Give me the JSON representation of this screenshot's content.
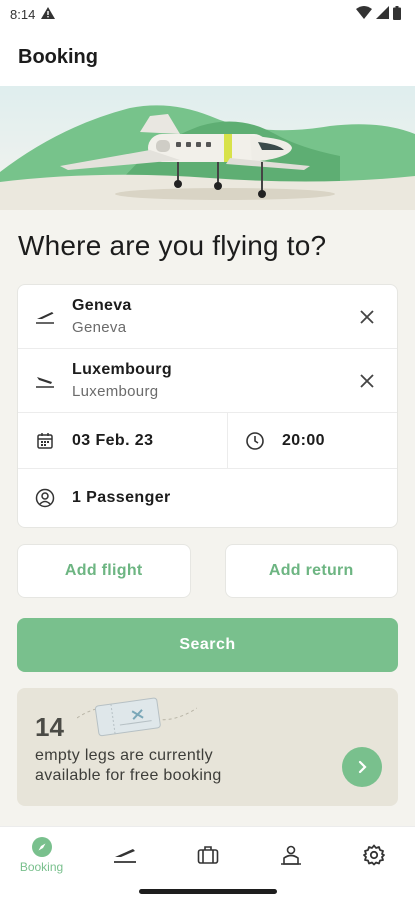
{
  "status_bar": {
    "time": "8:14"
  },
  "app_bar": {
    "title": "Booking"
  },
  "heading": "Where are you flying to?",
  "route": {
    "from": {
      "name": "Geneva",
      "city": "Geneva"
    },
    "to": {
      "name": "Luxembourg",
      "city": "Luxembourg"
    },
    "date": "03 Feb. 23",
    "time": "20:00",
    "passengers": "1 Passenger"
  },
  "buttons": {
    "add_flight": "Add flight",
    "add_return": "Add return",
    "search": "Search"
  },
  "promo": {
    "count": "14",
    "text": "empty legs are currently available for free booking"
  },
  "nav": {
    "items": [
      {
        "label": "Booking",
        "icon": "compass-icon",
        "active": true
      },
      {
        "label": "",
        "icon": "plane-takeoff-icon"
      },
      {
        "label": "",
        "icon": "luggage-icon"
      },
      {
        "label": "",
        "icon": "person-icon"
      },
      {
        "label": "",
        "icon": "gear-icon"
      }
    ]
  },
  "colors": {
    "accent": "#79c08d",
    "background": "#f4f3ee"
  }
}
